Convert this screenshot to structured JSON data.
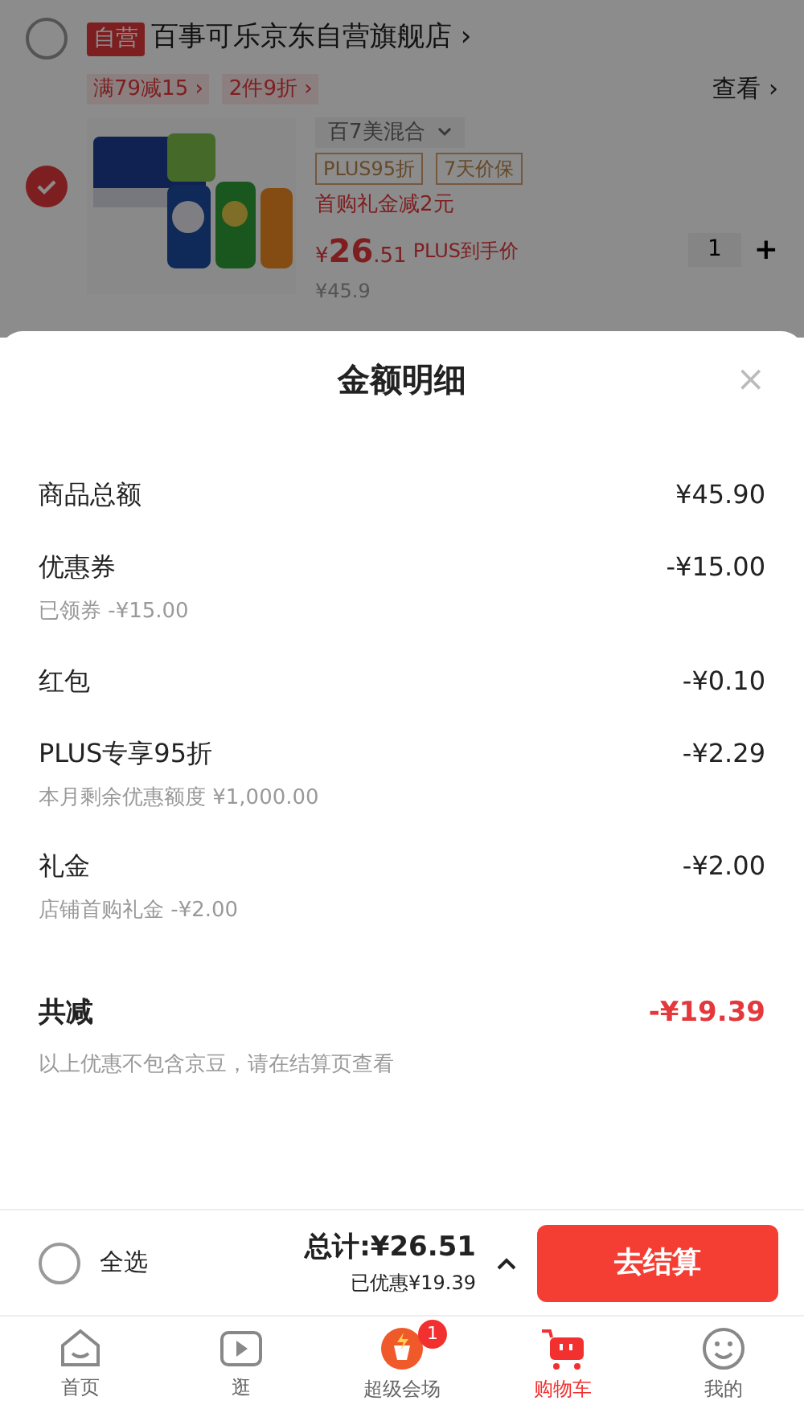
{
  "store": {
    "checked": false,
    "badge": "自营",
    "name": "百事可乐京东自营旗舰店",
    "arrow": "›"
  },
  "promos": [
    {
      "label": "满79减15 ›"
    },
    {
      "label": "2件9折 ›"
    }
  ],
  "view_link": "查看 ›",
  "product": {
    "checked": true,
    "variant": "百7美混合",
    "tags": [
      "PLUS95折",
      "7天价保"
    ],
    "gift": "首购礼金减2元",
    "price_symbol": "¥",
    "price_int": "26",
    "price_dec": ".51",
    "price_note": "PLUS到手价",
    "old_price": "¥45.9",
    "quantity": "1",
    "plus": "+"
  },
  "sheet": {
    "title": "金额明细",
    "close": "×",
    "rows": [
      {
        "label": "商品总额",
        "value": "¥45.90"
      },
      {
        "label": "优惠券",
        "value": "-¥15.00",
        "note": "已领券 -¥15.00"
      },
      {
        "label": "红包",
        "value": "-¥0.10"
      },
      {
        "label": "PLUS专享95折",
        "value": "-¥2.29",
        "note": "本月剩余优惠额度 ¥1,000.00"
      },
      {
        "label": "礼金",
        "value": "-¥2.00",
        "note": "店铺首购礼金 -¥2.00"
      }
    ],
    "total": {
      "label": "共减",
      "value": "-¥19.39",
      "note": "以上优惠不包含京豆，请在结算页查看"
    }
  },
  "checkout": {
    "select_all": {
      "label": "全选",
      "checked": false
    },
    "total": "总计:¥26.51",
    "saved": "已优惠¥19.39",
    "button": "去结算"
  },
  "nav": [
    {
      "label": "首页",
      "kind": "home",
      "selected": false
    },
    {
      "label": "逛",
      "kind": "play",
      "selected": false
    },
    {
      "label": "超级会场",
      "kind": "venue",
      "selected": false,
      "badge": "1"
    },
    {
      "label": "购物车",
      "kind": "cart",
      "selected": true
    },
    {
      "label": "我的",
      "kind": "smile",
      "selected": false
    }
  ]
}
